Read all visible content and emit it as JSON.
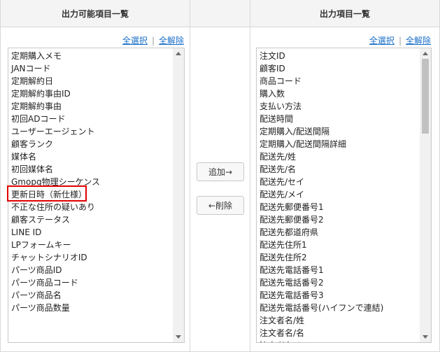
{
  "left_panel": {
    "title": "出力可能項目一覧",
    "select_all": "全選択",
    "separator": "|",
    "clear_all": "全解除",
    "items": [
      "定期購入メモ",
      "JANコード",
      "定期解約日",
      "定期解約事由ID",
      "定期解約事由",
      "初回ADコード",
      "ユーザーエージェント",
      "顧客ランク",
      "媒体名",
      "初回媒体名",
      "Gmopg物理シーケンス",
      "更新日時（新仕様）",
      "不正な住所の疑いあり",
      "顧客ステータス",
      "LINE ID",
      "LPフォームキー",
      "チャットシナリオID",
      "パーツ商品ID",
      "パーツ商品コード",
      "パーツ商品名",
      "パーツ商品数量"
    ],
    "highlighted_item": "更新日時（新仕様）"
  },
  "actions": {
    "add_label": "追加→",
    "remove_label": "←削除"
  },
  "right_panel": {
    "title": "出力項目一覧",
    "select_all": "全選択",
    "separator": "|",
    "clear_all": "全解除",
    "items": [
      "注文ID",
      "顧客ID",
      "商品コード",
      "購入数",
      "支払い方法",
      "配送時間",
      "定期購入/配送間隔",
      "定期購入/配送間隔詳細",
      "配送先/姓",
      "配送先/名",
      "配送先/セイ",
      "配送先/メイ",
      "配送先郵便番号1",
      "配送先郵便番号2",
      "配送先都道府県",
      "配送先住所1",
      "配送先住所2",
      "配送先電話番号1",
      "配送先電話番号2",
      "配送先電話番号3",
      "配送先電話番号(ハイフンで連結)",
      "注文者名/姓",
      "注文者名/名",
      "注文者名/セイ"
    ],
    "scroll_position": 0.0
  },
  "colors": {
    "link": "#1a6fc9",
    "highlight_border": "#e00000",
    "header_bg": "#f4f4f4"
  }
}
